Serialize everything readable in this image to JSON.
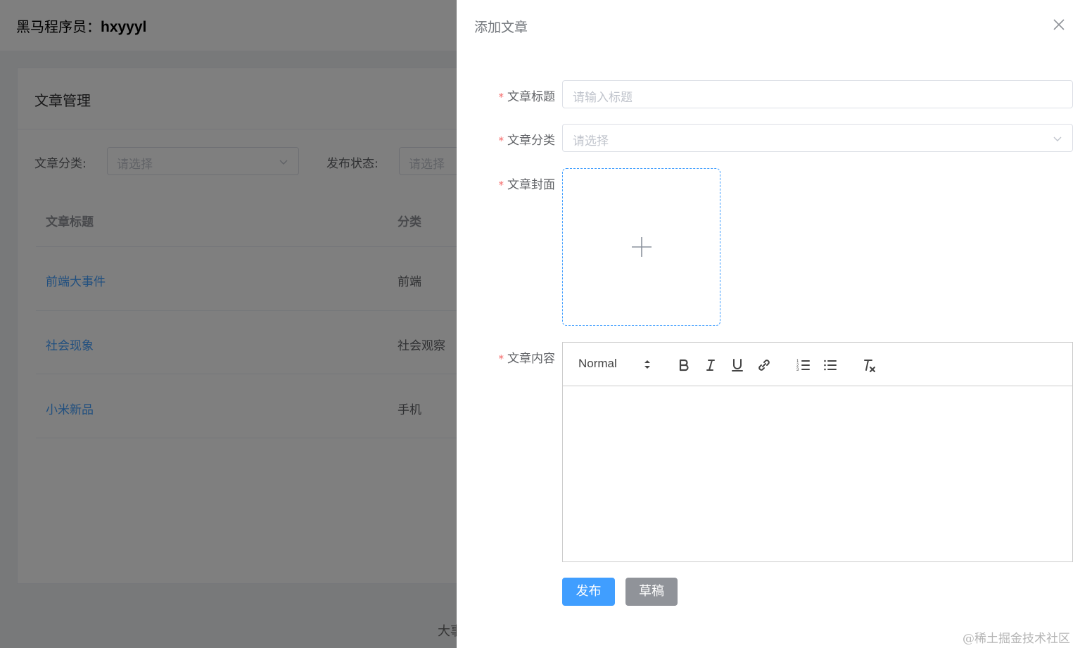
{
  "header": {
    "user_prefix": "黑马程序员：",
    "username": "hxyyyl"
  },
  "card": {
    "title": "文章管理",
    "filters": {
      "category_label": "文章分类:",
      "category_placeholder": "请选择",
      "state_label": "发布状态:",
      "state_placeholder": "请选择"
    },
    "table": {
      "columns": [
        "文章标题",
        "分类"
      ],
      "rows": [
        {
          "title": "前端大事件",
          "category": "前端"
        },
        {
          "title": "社会现象",
          "category": "社会观察"
        },
        {
          "title": "小米新品",
          "category": "手机"
        }
      ]
    }
  },
  "footer": {
    "text": "大事"
  },
  "drawer": {
    "title": "添加文章",
    "form": {
      "title_label": "文章标题",
      "title_placeholder": "请输入标题",
      "category_label": "文章分类",
      "category_placeholder": "请选择",
      "cover_label": "文章封面",
      "content_label": "文章内容"
    },
    "editor": {
      "header_picker": "Normal",
      "tools": [
        "bold-icon",
        "italic-icon",
        "underline-icon",
        "link-icon",
        "ordered-list-icon",
        "bullet-list-icon",
        "clear-format-icon"
      ]
    },
    "buttons": {
      "publish": "发布",
      "draft": "草稿"
    }
  },
  "watermark": "@稀土掘金技术社区",
  "colors": {
    "primary": "#409eff",
    "info": "#909399",
    "danger": "#f56c6c",
    "overlay": "rgba(0,0,0,0.5)"
  }
}
